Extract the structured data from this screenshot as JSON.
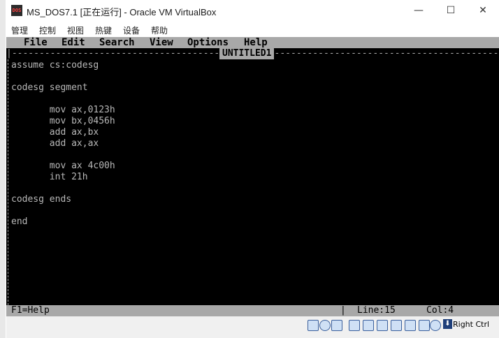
{
  "window": {
    "title": "MS_DOS7.1 [正在运行] - Oracle VM VirtualBox",
    "icon_label": "DOS",
    "minimize": "—",
    "maximize": "☐",
    "close": "✕"
  },
  "vbox_menu": [
    "管理",
    "控制",
    "视图",
    "热键",
    "设备",
    "帮助"
  ],
  "dos_menu": [
    "File",
    "Edit",
    "Search",
    "View",
    "Options",
    "Help"
  ],
  "editor": {
    "filename": "UNTITLED1",
    "lines": [
      "assume cs:codesg",
      "",
      "codesg segment",
      "",
      "       mov ax,0123h",
      "       mov bx,0456h",
      "       add ax,bx",
      "       add ax,ax",
      "",
      "       mov ax 4c00h",
      "       int 21h",
      "",
      "codesg ends",
      "",
      "end"
    ]
  },
  "status": {
    "help": "F1=Help",
    "line_label": "Line:15",
    "col_label": "Col:4"
  },
  "vbox_status": {
    "host_key": "Right Ctrl",
    "icons": [
      "hard-disk-icon",
      "optical-drive-icon",
      "audio-icon",
      "network-icon",
      "usb-icon",
      "shared-folder-icon",
      "display-icon",
      "screen-record-icon",
      "mouse-integration-icon"
    ]
  },
  "colors": {
    "dos_gray": "#a8a8a8",
    "dos_black": "#000000",
    "dos_text": "#b8b8b8"
  }
}
